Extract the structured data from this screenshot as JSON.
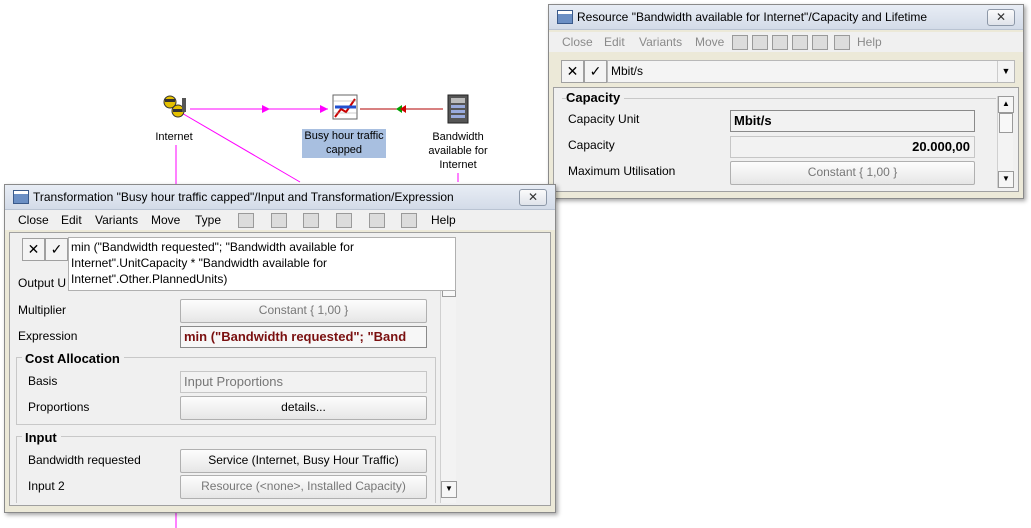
{
  "diagram": {
    "nodes": {
      "internet": {
        "label": "Internet",
        "icon": "internet-icon"
      },
      "busy_hour": {
        "label": "Busy hour traffic capped",
        "icon": "chart-icon"
      },
      "bandwidth": {
        "label": "Bandwidth available for Internet",
        "icon": "server-icon"
      }
    },
    "colors": {
      "link": "#ff00ff",
      "selection": "#a8bfe0"
    }
  },
  "resource_window": {
    "title": "Resource \"Bandwidth available for Internet\"/Capacity and Lifetime",
    "close_glyph": "✕",
    "menu": [
      "Close",
      "Edit",
      "Variants",
      "Move",
      "Help"
    ],
    "unit_value": "Mbit/s",
    "group_title": "Capacity",
    "rows": [
      {
        "label": "Capacity Unit",
        "value": "Mbit/s"
      },
      {
        "label": "Capacity",
        "value": "20.000,00"
      },
      {
        "label": "Maximum Utilisation",
        "value": "Constant { 1,00 }"
      }
    ]
  },
  "transform_window": {
    "title": "Transformation \"Busy hour traffic capped\"/Input and Transformation/Expression",
    "close_glyph": "✕",
    "menu": [
      "Close",
      "Edit",
      "Variants",
      "Move",
      "Type",
      "Help"
    ],
    "editor_text": "min (\"Bandwidth requested\"; \"Bandwidth available for Internet\".UnitCapacity * \"Bandwidth available for Internet\".Other.PlannedUnits)",
    "output_label": "Output U",
    "multiplier": {
      "label": "Multiplier",
      "value": "Constant { 1,00 }"
    },
    "expression": {
      "label": "Expression",
      "value": "min (\"Bandwidth requested\"; \"Band"
    },
    "cost_allocation": {
      "title": "Cost Allocation",
      "basis": {
        "label": "Basis",
        "value": "Input Proportions"
      },
      "proportions": {
        "label": "Proportions",
        "value": "details..."
      }
    },
    "input": {
      "title": "Input",
      "rows": [
        {
          "label": "Bandwidth requested",
          "value": "Service (Internet, Busy Hour Traffic)"
        },
        {
          "label": "Input 2",
          "value": "Resource (<none>, Installed Capacity)"
        }
      ]
    },
    "colors": {
      "expression_text": "#7a1010"
    }
  }
}
